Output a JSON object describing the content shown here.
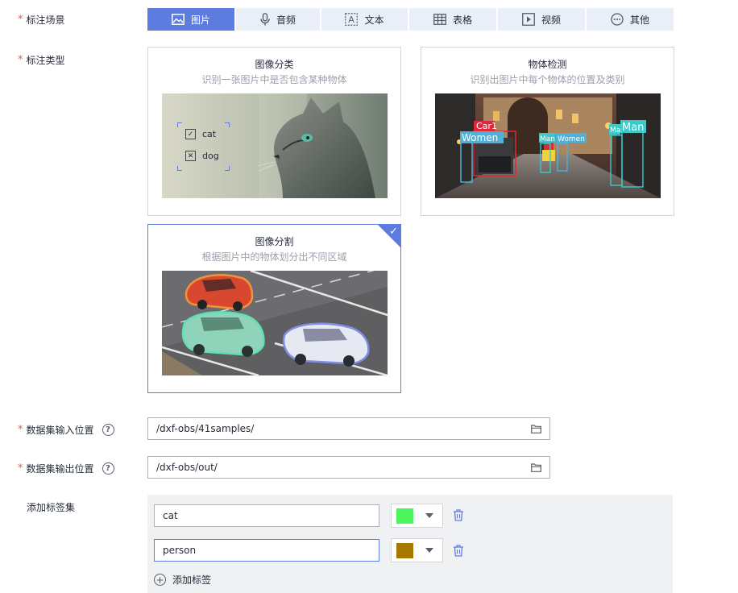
{
  "form": {
    "scene_label": "标注场景",
    "type_label": "标注类型",
    "input_label": "数据集输入位置",
    "output_label": "数据集输出位置",
    "labelset_label": "添加标签集",
    "required_mark": "*",
    "help_mark": "?"
  },
  "scene_tabs": [
    {
      "label": "图片",
      "icon": "image-icon",
      "active": true
    },
    {
      "label": "音频",
      "icon": "microphone-icon",
      "active": false
    },
    {
      "label": "文本",
      "icon": "text-icon",
      "active": false
    },
    {
      "label": "表格",
      "icon": "table-icon",
      "active": false
    },
    {
      "label": "视频",
      "icon": "video-icon",
      "active": false
    },
    {
      "label": "其他",
      "icon": "more-icon",
      "active": false
    }
  ],
  "cards": [
    {
      "title": "图像分类",
      "desc": "识别一张图片中是否包含某种物体",
      "selected": false,
      "options": [
        "cat",
        "dog"
      ]
    },
    {
      "title": "物体检测",
      "desc": "识别出图片中每个物体的位置及类别",
      "selected": false,
      "boxes": [
        "Car1",
        "Women",
        "Man",
        "Women",
        "Ma",
        "Man"
      ]
    },
    {
      "title": "图像分割",
      "desc": "根据图片中的物体划分出不同区域",
      "selected": true
    }
  ],
  "inputs": {
    "dataset_input": "/dxf-obs/41samples/",
    "dataset_output": "/dxf-obs/out/"
  },
  "labels": [
    {
      "name": "cat",
      "color": "#4cf55c"
    },
    {
      "name": "person",
      "color": "#a67800"
    }
  ],
  "add_tag_label": "添加标签",
  "colors": {
    "accent": "#5e7ce0",
    "tab_bg": "#e9eef8",
    "required": "#ee5a4f"
  }
}
